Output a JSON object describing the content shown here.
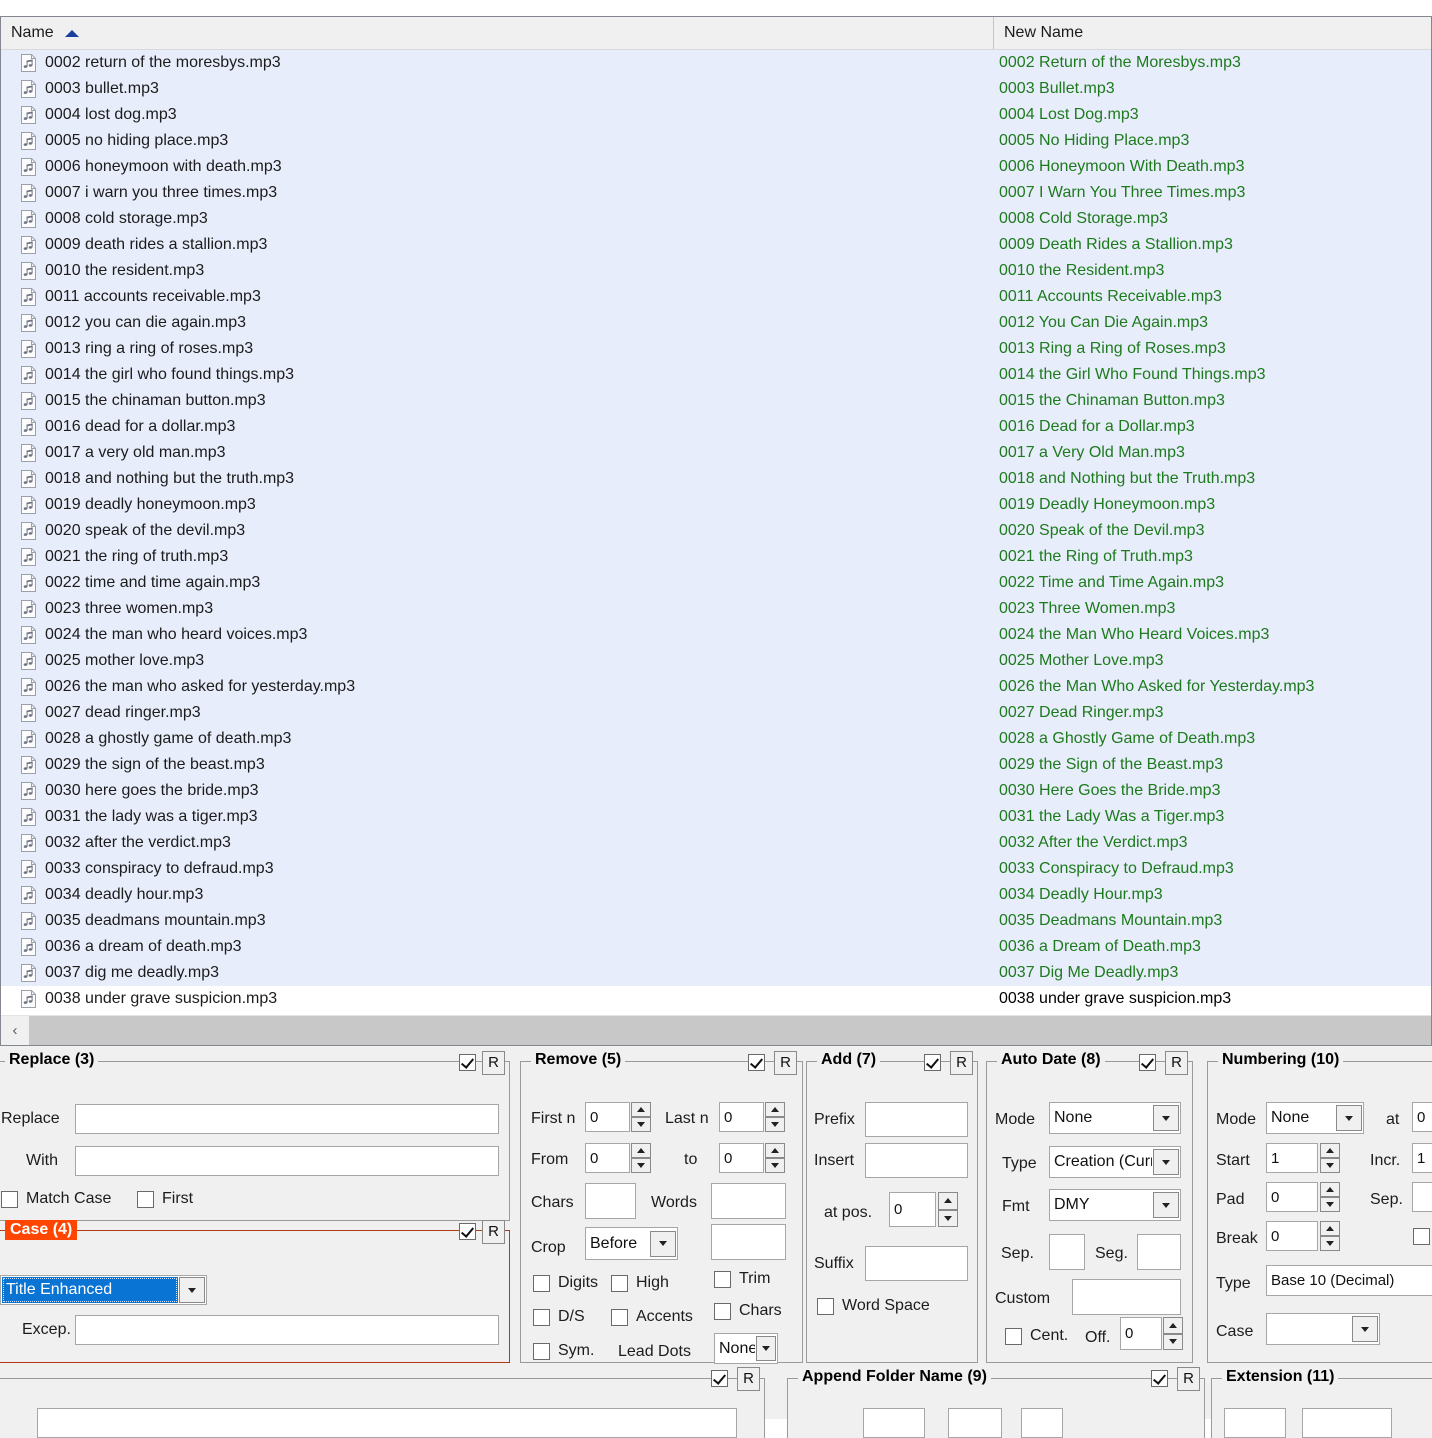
{
  "list": {
    "columns": {
      "name": "Name",
      "new_name": "New Name"
    },
    "sort_indicator": "ascending-sort-arrow",
    "rows": [
      {
        "icon": "music-file-icon",
        "name": "0002 return of the moresbys.mp3",
        "new": "0002 Return of the Moresbys.mp3",
        "selected": true,
        "changed": true
      },
      {
        "icon": "music-file-icon",
        "name": "0003 bullet.mp3",
        "new": "0003 Bullet.mp3",
        "selected": true,
        "changed": true
      },
      {
        "icon": "music-file-icon",
        "name": "0004 lost dog.mp3",
        "new": "0004 Lost Dog.mp3",
        "selected": true,
        "changed": true
      },
      {
        "icon": "music-file-icon",
        "name": "0005 no hiding place.mp3",
        "new": "0005 No Hiding Place.mp3",
        "selected": true,
        "changed": true
      },
      {
        "icon": "music-file-icon",
        "name": "0006 honeymoon with death.mp3",
        "new": "0006 Honeymoon With Death.mp3",
        "selected": true,
        "changed": true
      },
      {
        "icon": "music-file-icon",
        "name": "0007 i warn you three times.mp3",
        "new": "0007 I Warn You Three Times.mp3",
        "selected": true,
        "changed": true
      },
      {
        "icon": "music-file-icon",
        "name": "0008 cold storage.mp3",
        "new": "0008 Cold Storage.mp3",
        "selected": true,
        "changed": true
      },
      {
        "icon": "music-file-icon",
        "name": "0009 death rides a stallion.mp3",
        "new": "0009 Death Rides a Stallion.mp3",
        "selected": true,
        "changed": true
      },
      {
        "icon": "music-file-icon",
        "name": "0010 the resident.mp3",
        "new": "0010 the Resident.mp3",
        "selected": true,
        "changed": true
      },
      {
        "icon": "music-file-icon",
        "name": "0011 accounts receivable.mp3",
        "new": "0011 Accounts Receivable.mp3",
        "selected": true,
        "changed": true
      },
      {
        "icon": "music-file-icon",
        "name": "0012 you can die again.mp3",
        "new": "0012 You Can Die Again.mp3",
        "selected": true,
        "changed": true
      },
      {
        "icon": "music-file-icon",
        "name": "0013 ring a ring of roses.mp3",
        "new": "0013 Ring a Ring of Roses.mp3",
        "selected": true,
        "changed": true
      },
      {
        "icon": "music-file-icon",
        "name": "0014 the girl who found things.mp3",
        "new": "0014 the Girl Who Found Things.mp3",
        "selected": true,
        "changed": true
      },
      {
        "icon": "music-file-icon",
        "name": "0015 the chinaman button.mp3",
        "new": "0015 the Chinaman Button.mp3",
        "selected": true,
        "changed": true
      },
      {
        "icon": "music-file-icon",
        "name": "0016 dead for a dollar.mp3",
        "new": "0016 Dead for a Dollar.mp3",
        "selected": true,
        "changed": true
      },
      {
        "icon": "music-file-icon",
        "name": "0017 a very old man.mp3",
        "new": "0017 a Very Old Man.mp3",
        "selected": true,
        "changed": true
      },
      {
        "icon": "music-file-icon",
        "name": "0018 and nothing but the truth.mp3",
        "new": "0018 and Nothing but the Truth.mp3",
        "selected": true,
        "changed": true
      },
      {
        "icon": "music-file-icon",
        "name": "0019 deadly honeymoon.mp3",
        "new": "0019 Deadly Honeymoon.mp3",
        "selected": true,
        "changed": true
      },
      {
        "icon": "music-file-icon",
        "name": "0020 speak of the devil.mp3",
        "new": "0020 Speak of the Devil.mp3",
        "selected": true,
        "changed": true
      },
      {
        "icon": "music-file-icon",
        "name": "0021 the ring of truth.mp3",
        "new": "0021 the Ring of Truth.mp3",
        "selected": true,
        "changed": true
      },
      {
        "icon": "music-file-icon",
        "name": "0022 time and time again.mp3",
        "new": "0022 Time and Time Again.mp3",
        "selected": true,
        "changed": true
      },
      {
        "icon": "music-file-icon",
        "name": "0023 three women.mp3",
        "new": "0023 Three Women.mp3",
        "selected": true,
        "changed": true
      },
      {
        "icon": "music-file-icon",
        "name": "0024 the man who heard voices.mp3",
        "new": "0024 the Man Who Heard Voices.mp3",
        "selected": true,
        "changed": true
      },
      {
        "icon": "music-file-icon",
        "name": "0025 mother love.mp3",
        "new": "0025 Mother Love.mp3",
        "selected": true,
        "changed": true
      },
      {
        "icon": "music-file-icon",
        "name": "0026 the man who asked for yesterday.mp3",
        "new": "0026 the Man Who Asked for Yesterday.mp3",
        "selected": true,
        "changed": true
      },
      {
        "icon": "music-file-icon",
        "name": "0027 dead ringer.mp3",
        "new": "0027 Dead Ringer.mp3",
        "selected": true,
        "changed": true
      },
      {
        "icon": "music-file-icon",
        "name": "0028 a ghostly game of death.mp3",
        "new": "0028 a Ghostly Game of Death.mp3",
        "selected": true,
        "changed": true
      },
      {
        "icon": "music-file-icon",
        "name": "0029 the sign of the beast.mp3",
        "new": "0029 the Sign of the Beast.mp3",
        "selected": true,
        "changed": true
      },
      {
        "icon": "music-file-icon",
        "name": "0030 here goes the bride.mp3",
        "new": "0030 Here Goes the Bride.mp3",
        "selected": true,
        "changed": true
      },
      {
        "icon": "music-file-icon",
        "name": "0031 the lady was a tiger.mp3",
        "new": "0031 the Lady Was a Tiger.mp3",
        "selected": true,
        "changed": true
      },
      {
        "icon": "music-file-icon",
        "name": "0032 after the verdict.mp3",
        "new": "0032 After the Verdict.mp3",
        "selected": true,
        "changed": true
      },
      {
        "icon": "music-file-icon",
        "name": "0033 conspiracy to defraud.mp3",
        "new": "0033 Conspiracy to Defraud.mp3",
        "selected": true,
        "changed": true
      },
      {
        "icon": "music-file-icon",
        "name": "0034 deadly hour.mp3",
        "new": "0034 Deadly Hour.mp3",
        "selected": true,
        "changed": true
      },
      {
        "icon": "music-file-icon",
        "name": "0035 deadmans mountain.mp3",
        "new": "0035 Deadmans Mountain.mp3",
        "selected": true,
        "changed": true
      },
      {
        "icon": "music-file-icon",
        "name": "0036 a dream of death.mp3",
        "new": "0036 a Dream of Death.mp3",
        "selected": true,
        "changed": true
      },
      {
        "icon": "music-file-icon",
        "name": "0037 dig me deadly.mp3",
        "new": "0037 Dig Me Deadly.mp3",
        "selected": true,
        "changed": true
      },
      {
        "icon": "music-file-icon",
        "name": "0038 under grave suspicion.mp3",
        "new": "0038 under grave suspicion.mp3",
        "selected": false,
        "changed": false
      }
    ],
    "scroll_left_glyph": "‹"
  },
  "colors": {
    "selection": "#e8edfb",
    "changed_name": "#1d7a1d",
    "highlight_group": "#ff4500",
    "combo_selected": "#0a74d4",
    "sort_arrow": "#1b3fa0"
  },
  "panels": {
    "replace": {
      "title": "Replace (3)",
      "enabled": true,
      "reset_label": "R",
      "replace_label": "Replace",
      "replace_value": "",
      "with_label": "With",
      "with_value": "",
      "match_case_label": "Match Case",
      "match_case_checked": false,
      "first_label": "First",
      "first_checked": false
    },
    "case": {
      "title": "Case (4)",
      "enabled": true,
      "reset_label": "R",
      "mode": "Title Enhanced",
      "excep_label": "Excep.",
      "excep_value": ""
    },
    "remove": {
      "title": "Remove (5)",
      "enabled": true,
      "reset_label": "R",
      "first_n_label": "First n",
      "first_n_value": "0",
      "last_n_label": "Last n",
      "last_n_value": "0",
      "from_label": "From",
      "from_value": "0",
      "to_label": "to",
      "to_value": "0",
      "chars_label": "Chars",
      "chars_value": "",
      "words_label": "Words",
      "words_value": "",
      "crop_label": "Crop",
      "crop_mode": "Before",
      "crop_value": "",
      "digits_label": "Digits",
      "digits_checked": false,
      "high_label": "High",
      "high_checked": false,
      "ds_label": "D/S",
      "ds_checked": false,
      "accents_label": "Accents",
      "accents_checked": false,
      "sym_label": "Sym.",
      "sym_checked": false,
      "trim_label": "Trim",
      "trim_checked": false,
      "chars_cb_label": "Chars",
      "chars_cb_checked": false,
      "lead_dots_label": "Lead Dots",
      "lead_dots_value": "None"
    },
    "add": {
      "title": "Add (7)",
      "enabled": true,
      "reset_label": "R",
      "prefix_label": "Prefix",
      "prefix_value": "",
      "insert_label": "Insert",
      "insert_value": "",
      "at_pos_label": "at pos.",
      "at_pos_value": "0",
      "suffix_label": "Suffix",
      "suffix_value": "",
      "word_space_label": "Word Space",
      "word_space_checked": false
    },
    "auto_date": {
      "title": "Auto Date (8)",
      "enabled": true,
      "reset_label": "R",
      "mode_label": "Mode",
      "mode_value": "None",
      "type_label": "Type",
      "type_value": "Creation (Curr",
      "fmt_label": "Fmt",
      "fmt_value": "DMY",
      "sep_label": "Sep.",
      "sep_value": "",
      "seg_label": "Seg.",
      "seg_value": "",
      "custom_label": "Custom",
      "custom_value": "",
      "cent_label": "Cent.",
      "cent_checked": false,
      "off_label": "Off.",
      "off_value": "0"
    },
    "numbering": {
      "title": "Numbering (10)",
      "mode_label": "Mode",
      "mode_value": "None",
      "at_label": "at",
      "at_value": "0",
      "start_label": "Start",
      "start_value": "1",
      "incr_label": "Incr.",
      "incr_value": "1",
      "pad_label": "Pad",
      "pad_value": "0",
      "sep_label": "Sep.",
      "sep_value": "",
      "break_label": "Break",
      "break_value": "0",
      "extra_checked": false,
      "type_label": "Type",
      "type_value": "Base 10 (Decimal)",
      "case_label": "Case",
      "case_value": ""
    },
    "append_folder": {
      "title": "Append Folder Name (9)",
      "enabled": true,
      "reset_label": "R"
    },
    "extension": {
      "title": "Extension (11)"
    },
    "bottom_left": {
      "enabled": true,
      "reset_label": "R"
    }
  }
}
